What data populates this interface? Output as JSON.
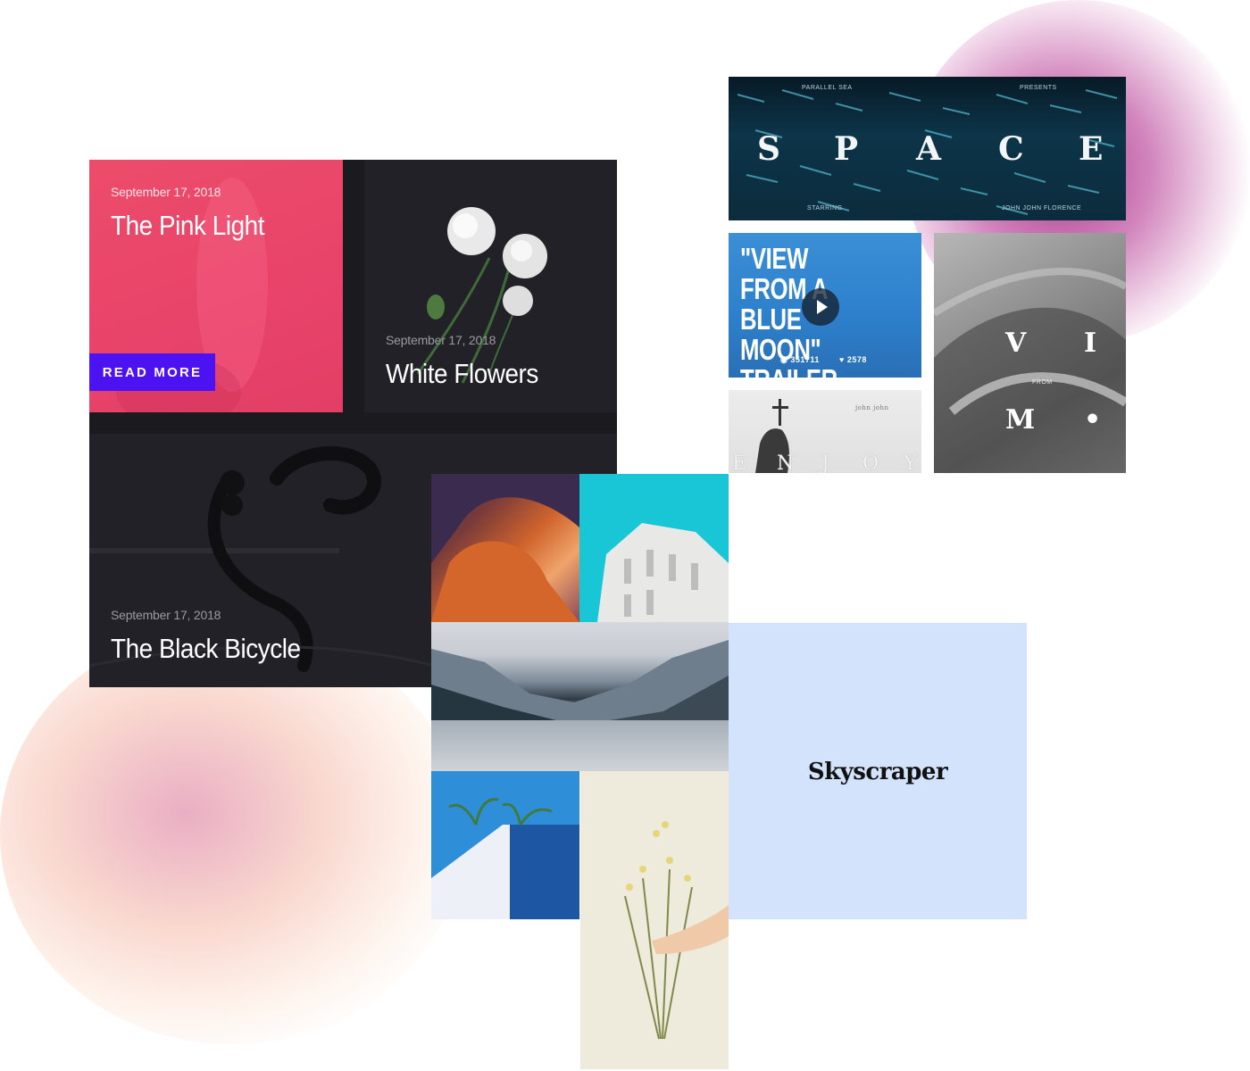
{
  "blog": {
    "cards": [
      {
        "date": "September 17, 2018",
        "title": "The Pink Light",
        "button": "READ MORE"
      },
      {
        "date": "September 17, 2018",
        "title": "White Flowers"
      },
      {
        "date": "September 17, 2018",
        "title": "The Black Bicycle"
      }
    ]
  },
  "videos": {
    "space": {
      "top_left": "PARALLEL SEA",
      "top_right": "PRESENTS",
      "letters": [
        "S",
        "P",
        "A",
        "C",
        "E"
      ],
      "bottom_left": "STARRING",
      "bottom_right": "JOHN JOHN FLORENCE"
    },
    "bluemoon": {
      "title": "\"VIEW FROM A BLUE MOON\" TRAILER",
      "views": "351711",
      "likes": "2578"
    },
    "enjoy": {
      "small": "john john",
      "letters": [
        "E",
        "N",
        "J",
        "O",
        "Y"
      ]
    },
    "vim": {
      "letters": [
        "V",
        "I",
        "M"
      ],
      "dot": "•",
      "small": "FROM"
    }
  },
  "portfolio": {
    "skyscraper_label": "Skyscraper"
  },
  "colors": {
    "pink": "#e8436a",
    "read_more": "#4c12f2",
    "dark_card": "#222128",
    "skyscraper_bg": "#d3e3fb"
  }
}
